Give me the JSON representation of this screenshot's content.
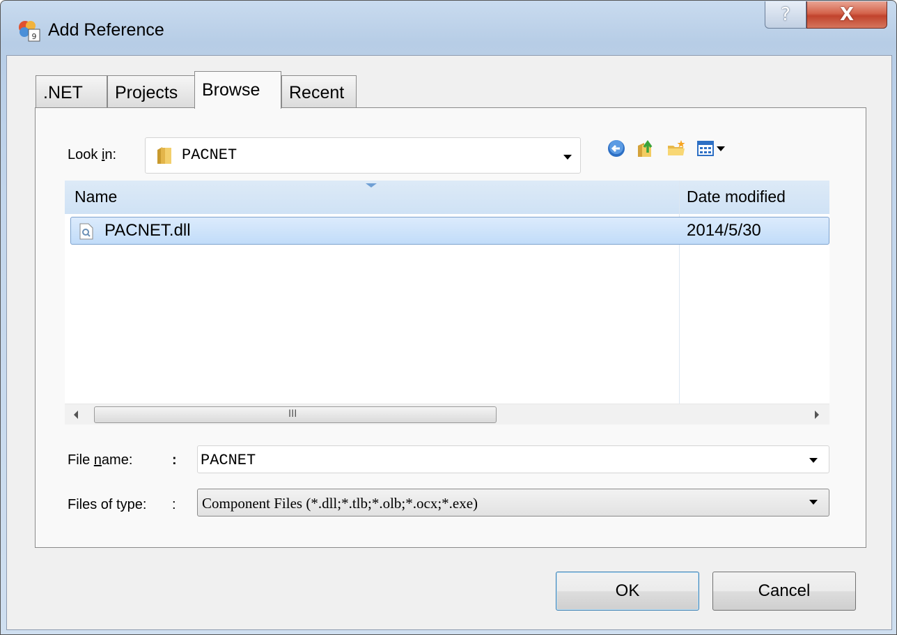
{
  "window": {
    "title": "Add Reference",
    "help_glyph": "?",
    "close_glyph": "X"
  },
  "tabs": [
    {
      "label": ".NET",
      "active": false
    },
    {
      "label": "Projects",
      "active": false
    },
    {
      "label": "Browse",
      "active": true
    },
    {
      "label": "Recent",
      "active": false
    }
  ],
  "browse": {
    "look_in_label_pre": "Look ",
    "look_in_label_accel": "i",
    "look_in_label_post": "n:",
    "look_in_value": "PACNET",
    "toolbar": {
      "back_icon": "back-icon",
      "up_icon": "up-folder-icon",
      "new_folder_icon": "new-folder-icon",
      "views_icon": "view-menu-icon"
    },
    "columns": [
      "Name",
      "Date modified"
    ],
    "files": [
      {
        "name": "PACNET.dll",
        "date": "2014/5/30",
        "selected": true,
        "icon": "dll-file-icon"
      }
    ],
    "scroll_grip": "III",
    "file_name_label_pre": "File ",
    "file_name_label_accel": "n",
    "file_name_label_post": "ame:",
    "file_name_colon": ":",
    "file_name_value": "PACNET",
    "file_type_label": "Files of type:",
    "file_type_colon": ":",
    "file_type_value": "Component Files (*.dll;*.tlb;*.olb;*.ocx;*.exe)"
  },
  "buttons": {
    "ok": "OK",
    "cancel": "Cancel"
  }
}
